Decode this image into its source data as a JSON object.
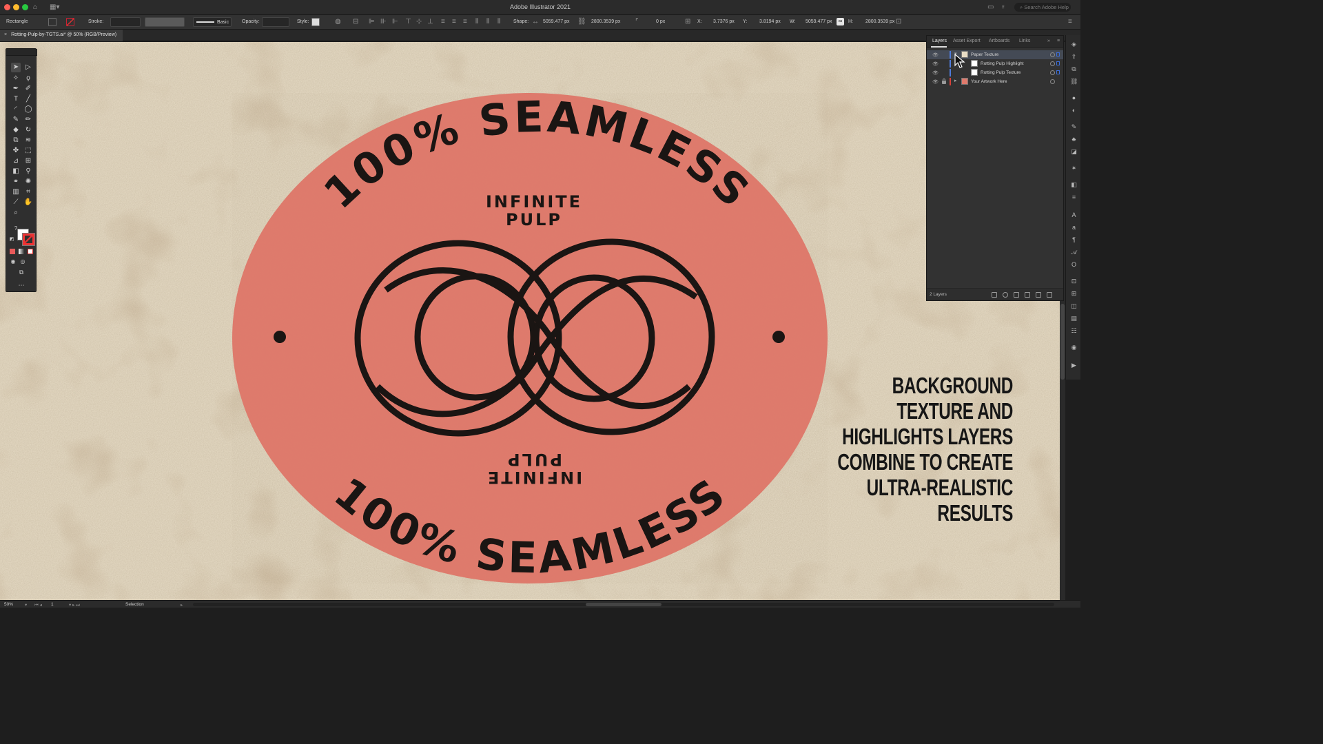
{
  "app": {
    "title": "Adobe Illustrator 2021",
    "help_placeholder": "Search Adobe Help"
  },
  "control_bar": {
    "object_type": "Rectangle",
    "stroke_label": "Stroke:",
    "stroke_style": "Basic",
    "opacity_label": "Opacity:",
    "style_label": "Style:",
    "shape_label": "Shape:",
    "shape_w": "5059.477 px",
    "shape_h": "2800.3539 px",
    "corner_radius": "0 px",
    "x_label": "X:",
    "x_value": "3.7376 px",
    "y_label": "Y:",
    "y_value": "3.8194 px",
    "w_label": "W:",
    "w_value": "5059.477 px",
    "h_label": "H:",
    "h_value": "2800.3539 px"
  },
  "document": {
    "tab_label": "Rotting-Pulp-by-TGTS.ai* @ 50% (RGB/Preview)"
  },
  "artwork": {
    "ring_top": "100% SEAMLESS",
    "ring_bottom": "100% SEAMLESS",
    "center_top": [
      "INFINITE",
      "PULP"
    ],
    "center_bottom": [
      "INFINITE",
      "PULP"
    ],
    "callout_lines": [
      "BACKGROUND",
      "TEXTURE AND",
      "HIGHLIGHTS LAYERS",
      "COMBINE TO CREATE",
      "ULTRA-REALISTIC",
      "RESULTS"
    ],
    "badge_color": "#e07a6c",
    "ink_color": "#1a1513",
    "paper_color": "#e7dcc6"
  },
  "layers_panel": {
    "tabs": [
      "Layers",
      "Asset Export",
      "Artboards",
      "Links"
    ],
    "active_tab": "Layers",
    "layers": [
      {
        "name": "Paper Texture",
        "color": "#4f7cdb",
        "locked": false,
        "expanded": true,
        "selected": true
      },
      {
        "name": "Rotting Pulp Highlight",
        "color": "#4f7cdb",
        "sublayer": true
      },
      {
        "name": "Rotting Pulp Texture",
        "color": "#4f7cdb",
        "sublayer": true
      },
      {
        "name": "Your Artwork Here",
        "color": "#d8413a",
        "locked": true,
        "expanded": false
      }
    ],
    "layer_count": "2 Layers"
  },
  "status_bar": {
    "zoom": "50%",
    "artboard_number": "1",
    "tool_name": "Selection"
  }
}
